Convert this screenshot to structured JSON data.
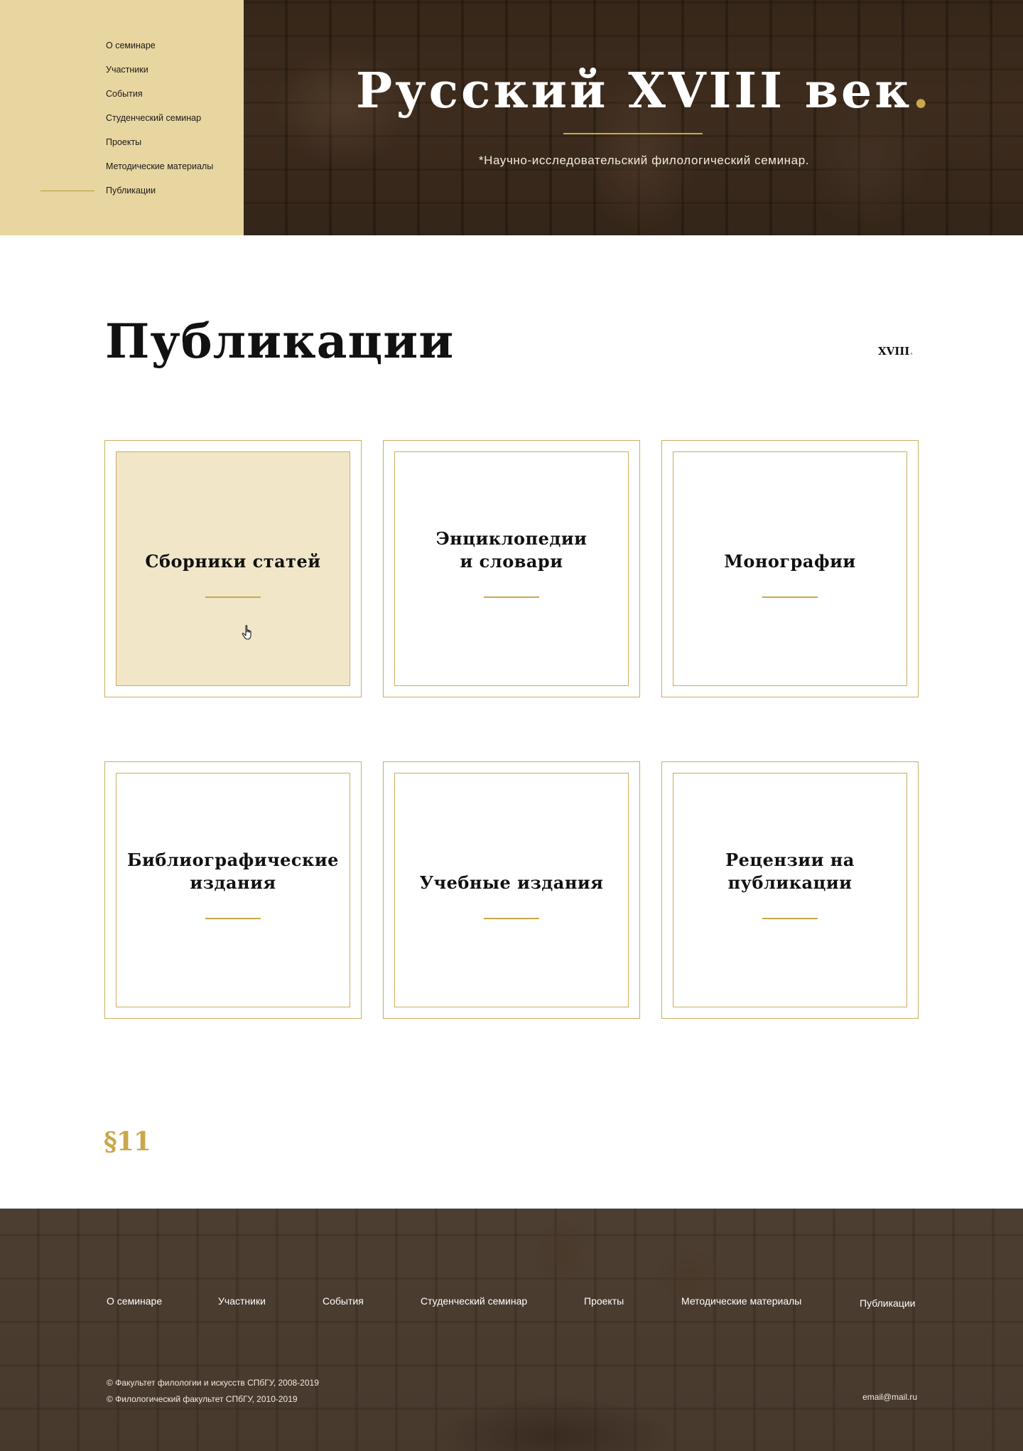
{
  "nav": {
    "items": [
      {
        "label": "О семинаре"
      },
      {
        "label": "Участники"
      },
      {
        "label": "События"
      },
      {
        "label": "Студенческий семинар"
      },
      {
        "label": "Проекты"
      },
      {
        "label": "Методические материалы"
      },
      {
        "label": "Публикации",
        "active": true
      }
    ]
  },
  "hero": {
    "title": "Русский XVIII век",
    "title_dot": ".",
    "subtitle": "*Научно-исследовательский филологический семинар."
  },
  "page": {
    "title": "Публикации",
    "mini_logo": "XVIII",
    "mini_logo_dot": "."
  },
  "cards": [
    {
      "label": "Сборники статей",
      "hover": true
    },
    {
      "label": "Энциклопедии и словари"
    },
    {
      "label": "Монографии"
    },
    {
      "label": "Библиографические издания"
    },
    {
      "label": "Учебные издания"
    },
    {
      "label": "Рецензии на публикации"
    }
  ],
  "section_mark": "§11",
  "footer": {
    "nav": [
      "О семинаре",
      "Участники",
      "События",
      "Студенческий семинар",
      "Проекты",
      "Методические материалы",
      "Публикации"
    ],
    "copyright_1": "© Факультет филологии и искусств СПбГУ, 2008-2019",
    "copyright_2": "© Филологический факультет СПбГУ, 2010-2019",
    "email": "email@mail.ru"
  },
  "colors": {
    "accent": "#c9a84c",
    "sidebar_bg": "#e8d6a0",
    "card_border": "#c9ad62",
    "card_hover_bg": "#f1e6c8"
  },
  "icons": {
    "cursor": "hand-pointer-icon"
  }
}
